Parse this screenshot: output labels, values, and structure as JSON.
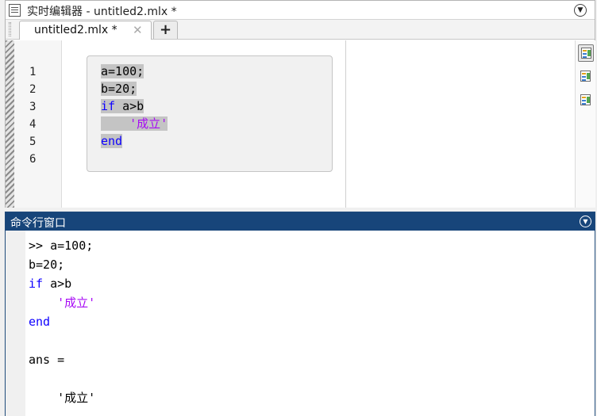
{
  "window": {
    "title": "实时编辑器 - untitled2.mlx *"
  },
  "tabs": [
    {
      "label": "untitled2.mlx *",
      "close_symbol": "✕"
    }
  ],
  "tab_add_label": "+",
  "editor": {
    "line_numbers": [
      "1",
      "2",
      "3",
      "4",
      "5",
      "6"
    ],
    "code": [
      {
        "text": "a=100;",
        "type": "plain"
      },
      {
        "text": "b=20;",
        "type": "plain"
      },
      {
        "parts": [
          {
            "text": "if",
            "type": "keyword"
          },
          {
            "text": " a>b",
            "type": "plain"
          }
        ]
      },
      {
        "text": "    '成立'",
        "type": "string"
      },
      {
        "text": "end",
        "type": "keyword"
      },
      {
        "text": "",
        "type": "plain"
      }
    ]
  },
  "side_tools": [
    {
      "icon": "output-inline-icon",
      "active": true
    },
    {
      "icon": "output-right-icon",
      "active": false
    },
    {
      "icon": "hide-code-icon",
      "active": false
    }
  ],
  "command_window": {
    "title": "命令行窗口",
    "lines": [
      {
        "text": ">> a=100;",
        "type": "plain"
      },
      {
        "text": "b=20;",
        "type": "plain"
      },
      {
        "parts": [
          {
            "text": "if",
            "type": "keyword"
          },
          {
            "text": " a>b",
            "type": "plain"
          }
        ]
      },
      {
        "text": "    '成立'",
        "type": "string"
      },
      {
        "text": "end",
        "type": "keyword"
      },
      {
        "text": "",
        "type": "plain"
      },
      {
        "text": "ans =",
        "type": "plain"
      },
      {
        "text": "",
        "type": "plain"
      },
      {
        "text": "    '成立'",
        "type": "plain"
      }
    ]
  },
  "colors": {
    "keyword": "#0e00ff",
    "string": "#a709f5",
    "command_header": "#17457a"
  }
}
